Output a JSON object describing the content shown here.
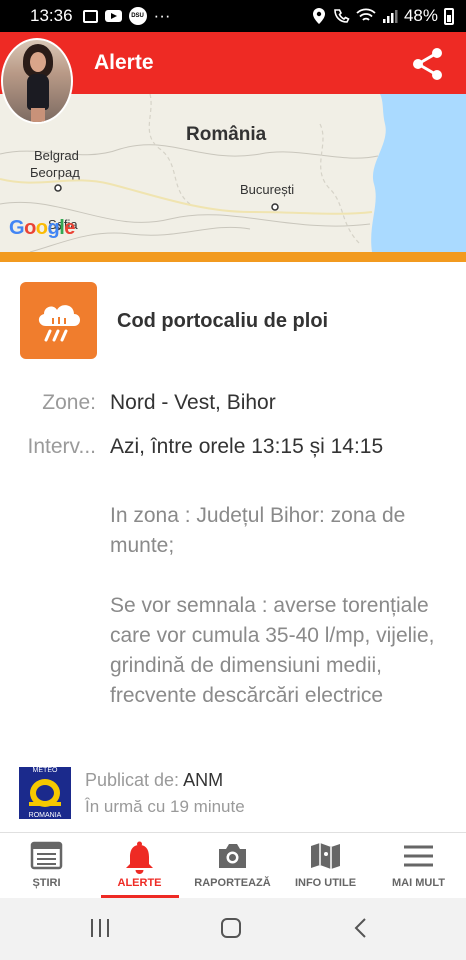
{
  "status_bar": {
    "time": "13:36",
    "dsu_label": "DSU",
    "more": "···",
    "battery": "48%"
  },
  "app_bar": {
    "title": "Alerte",
    "share_icon": "share-icon",
    "avatar": "profile-photo"
  },
  "map": {
    "country": "România",
    "city_belgrad": "Belgrad",
    "city_beograd": "Београд",
    "city_bucuresti": "București",
    "city_sofia": "Sofia",
    "google": "Google"
  },
  "alert": {
    "icon": "rain-cloud-icon",
    "title": "Cod portocaliu de ploi",
    "color": "#f07d2d",
    "zone_label": "Zone:",
    "zone_value": "Nord - Vest, Bihor",
    "interval_label": "Interv...",
    "interval_value": "Azi, între orele 13:15 și 14:15",
    "description_1": "In zona : Județul Bihor: zona de munte;",
    "description_2": "Se vor semnala : averse torențiale care vor cumula 35-40 l/mp, vijelie, grindină de dimensiuni medii, frecvente descărcări electrice"
  },
  "publisher": {
    "logo_top": "METEO",
    "logo_bottom": "ROMANIA",
    "label": "Publicat de: ",
    "name": "ANM",
    "time": "În urmă cu 19 minute"
  },
  "bottom_nav": {
    "items": [
      {
        "label": "ȘTIRI",
        "icon": "newspaper-icon"
      },
      {
        "label": "ALERTE",
        "icon": "bell-icon"
      },
      {
        "label": "RAPORTEAZĂ",
        "icon": "camera-icon"
      },
      {
        "label": "INFO UTILE",
        "icon": "map-icon"
      },
      {
        "label": "MAI MULT",
        "icon": "menu-icon"
      }
    ],
    "active_index": 1,
    "accent": "#ee2a24"
  }
}
